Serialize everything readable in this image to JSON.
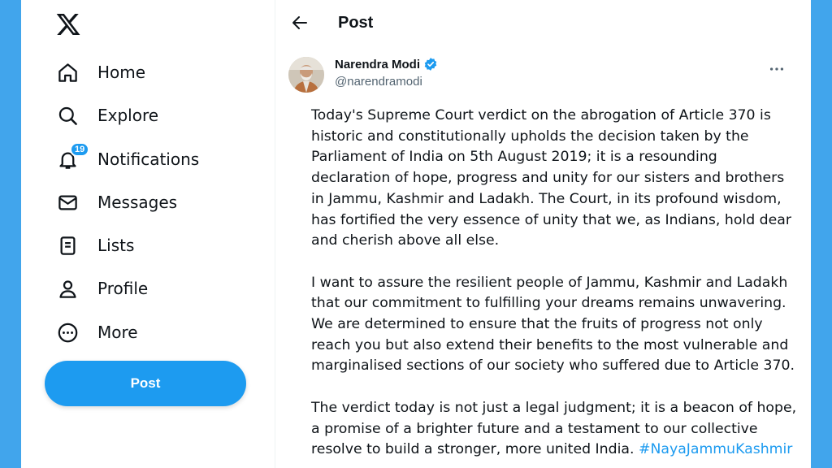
{
  "colors": {
    "accent": "#1d9bf0",
    "background": "#41a5ec",
    "text": "#0f1419",
    "muted": "#536471"
  },
  "sidebar": {
    "logo_icon": "x-logo-icon",
    "items": [
      {
        "label": "Home",
        "icon": "home-icon"
      },
      {
        "label": "Explore",
        "icon": "search-icon"
      },
      {
        "label": "Notifications",
        "icon": "bell-icon",
        "badge": "19"
      },
      {
        "label": "Messages",
        "icon": "envelope-icon"
      },
      {
        "label": "Lists",
        "icon": "list-icon"
      },
      {
        "label": "Profile",
        "icon": "person-icon"
      },
      {
        "label": "More",
        "icon": "more-circle-icon"
      }
    ],
    "post_button": "Post"
  },
  "header": {
    "title": "Post",
    "back_icon": "arrow-left-icon"
  },
  "tweet": {
    "author_name": "Narendra Modi",
    "author_handle": "@narendramodi",
    "verified": true,
    "paragraph_1": "Today's Supreme Court verdict on the abrogation of Article 370 is historic and constitutionally upholds the decision taken by the Parliament of India on 5th August 2019; it is a resounding declaration of hope, progress and unity for our sisters and brothers in Jammu, Kashmir and Ladakh. The Court, in its profound wisdom, has fortified the very essence of unity that we, as Indians, hold dear and cherish above all else.",
    "paragraph_2": "I want to assure the resilient people of Jammu, Kashmir and Ladakh that our commitment to fulfilling your dreams remains unwavering. We are determined to ensure that the fruits of progress not only reach you but also extend their benefits to the most vulnerable and marginalised sections of our society who suffered due to Article 370.",
    "paragraph_3": "The verdict today is not just a legal judgment; it is a beacon of hope, a promise of a brighter future and a testament to our collective resolve to build a stronger, more united India.",
    "hashtag": "#NayaJammuKashmir"
  }
}
